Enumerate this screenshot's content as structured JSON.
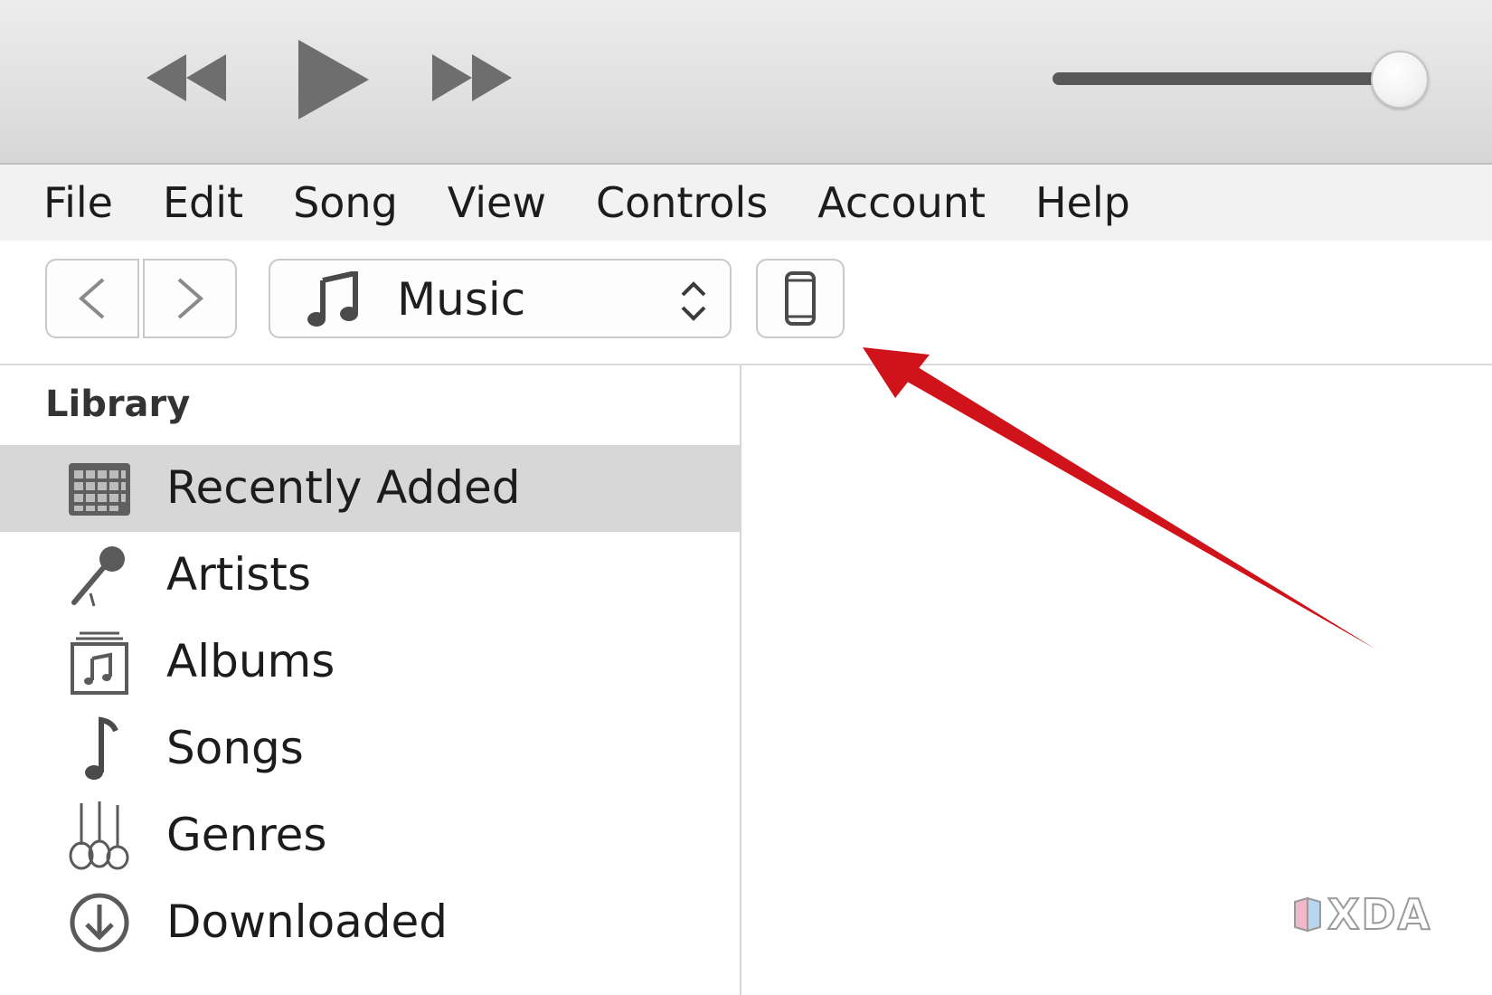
{
  "menu": {
    "items": [
      "File",
      "Edit",
      "Song",
      "View",
      "Controls",
      "Account",
      "Help"
    ]
  },
  "player": {
    "volume_level": 0.95
  },
  "toolbar": {
    "media_type": "Music"
  },
  "sidebar": {
    "heading": "Library",
    "items": [
      {
        "label": "Recently Added",
        "icon": "recently-added-icon",
        "selected": true
      },
      {
        "label": "Artists",
        "icon": "microphone-icon",
        "selected": false
      },
      {
        "label": "Albums",
        "icon": "album-icon",
        "selected": false
      },
      {
        "label": "Songs",
        "icon": "music-note-icon",
        "selected": false
      },
      {
        "label": "Genres",
        "icon": "guitars-icon",
        "selected": false
      },
      {
        "label": "Downloaded",
        "icon": "download-icon",
        "selected": false
      }
    ]
  },
  "watermark": {
    "text": "XDA"
  },
  "colors": {
    "annotation_arrow": "#d0121b",
    "selection": "#d7d7d7",
    "icon_gray": "#5a5a5a"
  }
}
